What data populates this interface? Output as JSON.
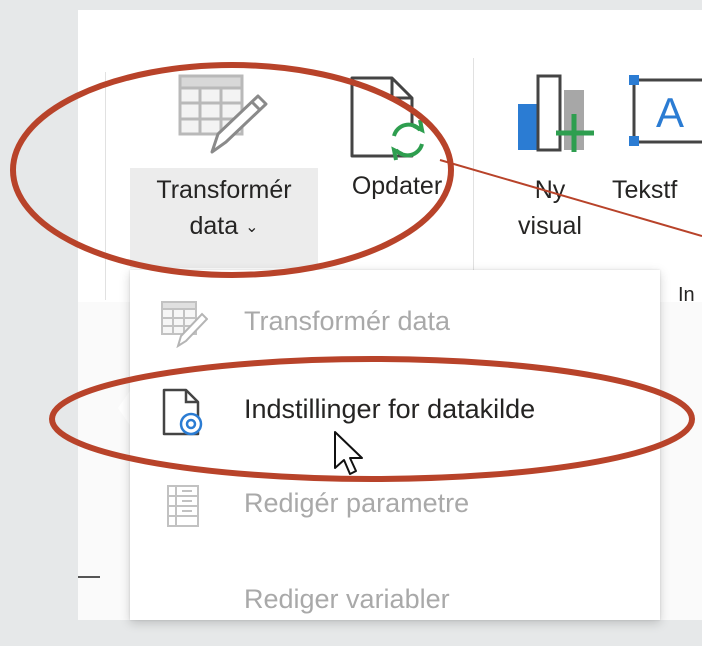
{
  "ribbon": {
    "transform_data": {
      "line1": "Transformér",
      "line2": "data",
      "chevron": "⌄",
      "icon": "table-edit-icon"
    },
    "refresh": {
      "label": "Opdater",
      "icon": "refresh-document-icon"
    },
    "new_visual": {
      "line1": "Ny",
      "line2": "visual",
      "icon": "new-visual-icon"
    },
    "text_box": {
      "label": "Tekstf",
      "icon": "text-box-icon"
    },
    "group_label_partial": "In"
  },
  "dropdown": {
    "items": [
      {
        "label": "Transformér data",
        "icon": "table-edit-icon",
        "enabled": false
      },
      {
        "label": "Indstillinger for datakilde",
        "icon": "data-source-settings-icon",
        "enabled": true,
        "hovered": true
      },
      {
        "label": "Redigér parametre",
        "icon": "parameters-icon",
        "enabled": false
      },
      {
        "label": "Rediger variabler",
        "icon": "variables-icon",
        "enabled": false
      }
    ]
  },
  "annotations": {
    "highlight_color": "#b8432a"
  }
}
